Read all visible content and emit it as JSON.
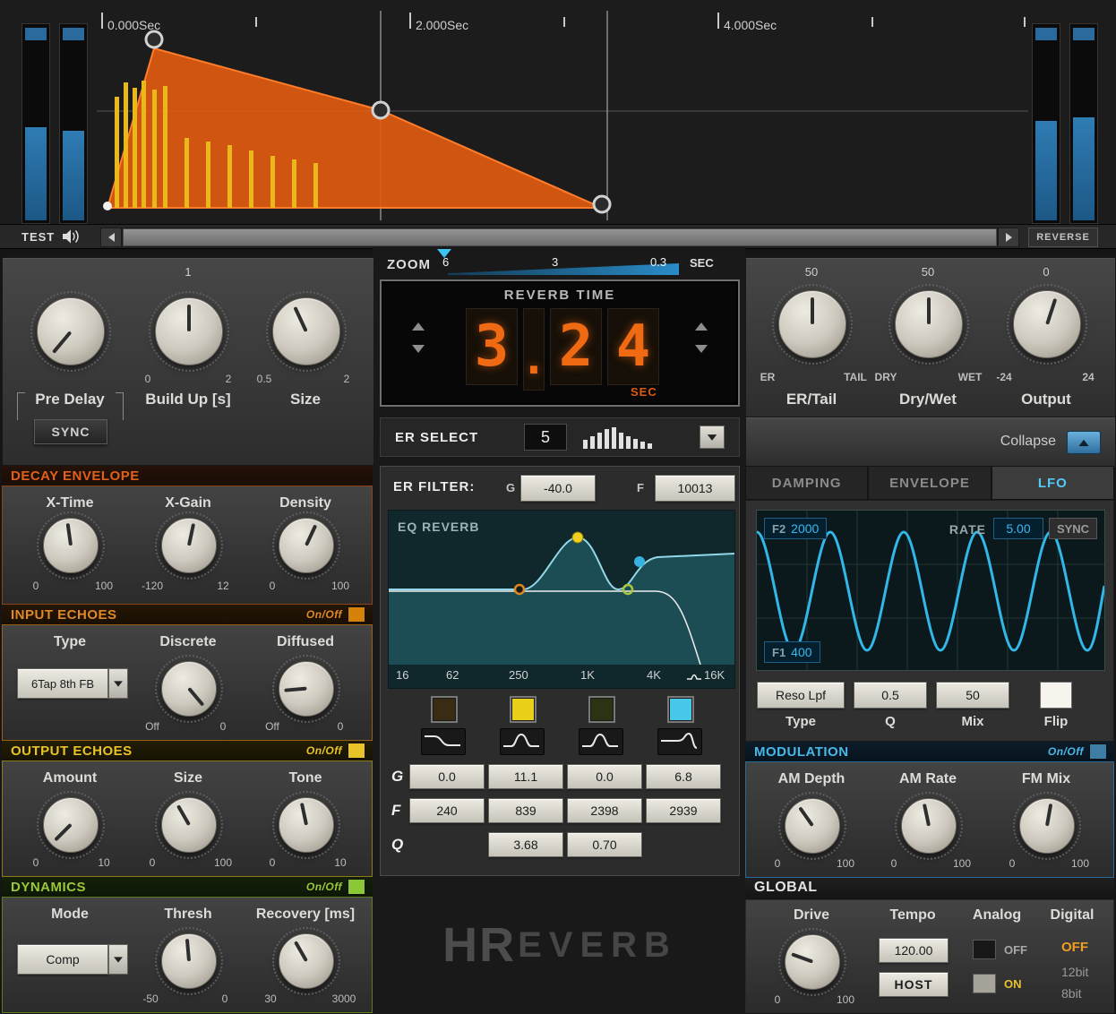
{
  "colors": {
    "accent_orange": "#e05a10",
    "accent_yellow": "#e8c428",
    "accent_green": "#9ac838",
    "accent_blue": "#48b8e8",
    "digit_orange": "#f06a14",
    "lfo_wave": "#30b8e8"
  },
  "top_display": {
    "time_labels": [
      "0.000Sec",
      "2.000Sec",
      "4.000Sec"
    ],
    "test_label": "TEST",
    "reverse_label": "REVERSE"
  },
  "zoom": {
    "label": "ZOOM",
    "tick_6": "6",
    "tick_3": "3",
    "tick_03": "0.3",
    "unit": "SEC"
  },
  "left": {
    "predelay": {
      "label": "Pre Delay",
      "sync": "SYNC"
    },
    "buildup": {
      "label": "Build Up [s]",
      "value": "1",
      "min": "0",
      "max": "2"
    },
    "size": {
      "label": "Size",
      "min": "0.5",
      "max": "2"
    },
    "decay": {
      "header": "DECAY ENVELOPE",
      "xtime": {
        "label": "X-Time",
        "min": "0",
        "max": "100"
      },
      "xgain": {
        "label": "X-Gain",
        "min": "-120",
        "max": "12"
      },
      "density": {
        "label": "Density",
        "min": "0",
        "max": "100"
      }
    },
    "input_echoes": {
      "header": "INPUT ECHOES",
      "onoff": "On/Off",
      "type_label": "Type",
      "type_value": "6Tap 8th FB",
      "discrete": {
        "label": "Discrete",
        "min": "Off",
        "max": "0"
      },
      "diffused": {
        "label": "Diffused",
        "min": "Off",
        "max": "0"
      }
    },
    "output_echoes": {
      "header": "OUTPUT ECHOES",
      "onoff": "On/Off",
      "amount": {
        "label": "Amount",
        "min": "0",
        "max": "10"
      },
      "size": {
        "label": "Size",
        "min": "0",
        "max": "100"
      },
      "tone": {
        "label": "Tone",
        "min": "0",
        "max": "10"
      }
    },
    "dynamics": {
      "header": "DYNAMICS",
      "onoff": "On/Off",
      "mode_label": "Mode",
      "mode_value": "Comp",
      "thresh": {
        "label": "Thresh",
        "min": "-50",
        "max": "0"
      },
      "recovery": {
        "label": "Recovery [ms]",
        "min": "30",
        "max": "3000"
      }
    }
  },
  "center": {
    "reverb_time": {
      "title": "REVERB TIME",
      "d1": "3",
      "dot": ".",
      "d2": "2",
      "d3": "4",
      "unit": "SEC"
    },
    "er_select": {
      "label": "ER SELECT",
      "value": "5"
    },
    "er_filter": {
      "label": "ER FILTER:",
      "g_label": "G",
      "g_value": "-40.0",
      "f_label": "F",
      "f_value": "10013"
    },
    "eq": {
      "title": "EQ REVERB",
      "freqs": [
        "16",
        "62",
        "250",
        "1K",
        "4K",
        "16K"
      ]
    },
    "bands": {
      "g_label": "G",
      "f_label": "F",
      "q_label": "Q",
      "g": [
        "0.0",
        "11.1",
        "0.0",
        "6.8"
      ],
      "f": [
        "240",
        "839",
        "2398",
        "2939"
      ],
      "q": [
        "3.68",
        "0.70"
      ]
    },
    "logo": {
      "h": "H",
      "r": "R",
      "everb": "EVERB"
    }
  },
  "right": {
    "ertail": {
      "label": "ER/Tail",
      "value": "50",
      "min": "ER",
      "max": "TAIL"
    },
    "drywet": {
      "label": "Dry/Wet",
      "value": "50",
      "min": "DRY",
      "max": "WET"
    },
    "output": {
      "label": "Output",
      "value": "0",
      "min": "-24",
      "max": "24"
    },
    "collapse_label": "Collapse",
    "tabs": {
      "damping": "DAMPING",
      "envelope": "ENVELOPE",
      "lfo": "LFO"
    },
    "lfo": {
      "f2_label": "F2",
      "f2_value": "2000",
      "rate_label": "RATE",
      "rate_value": "5.00",
      "sync_label": "SYNC",
      "f1_label": "F1",
      "f1_value": "400"
    },
    "filter": {
      "type_value": "Reso Lpf",
      "q_value": "0.5",
      "mix_value": "50",
      "type_label": "Type",
      "q_label": "Q",
      "mix_label": "Mix",
      "flip_label": "Flip"
    },
    "modulation": {
      "header": "MODULATION",
      "onoff": "On/Off",
      "am_depth": {
        "label": "AM Depth",
        "min": "0",
        "max": "100"
      },
      "am_rate": {
        "label": "AM Rate",
        "min": "0",
        "max": "100"
      },
      "fm_mix": {
        "label": "FM Mix",
        "min": "0",
        "max": "100"
      }
    },
    "global": {
      "header": "GLOBAL",
      "drive": {
        "label": "Drive",
        "min": "0",
        "max": "100"
      },
      "tempo_label": "Tempo",
      "tempo_value": "120.00",
      "host_label": "HOST",
      "analog_label": "Analog",
      "analog_off": "OFF",
      "analog_on": "ON",
      "digital_label": "Digital",
      "digital_off": "OFF",
      "digital_12": "12bit",
      "digital_8": "8bit"
    }
  }
}
